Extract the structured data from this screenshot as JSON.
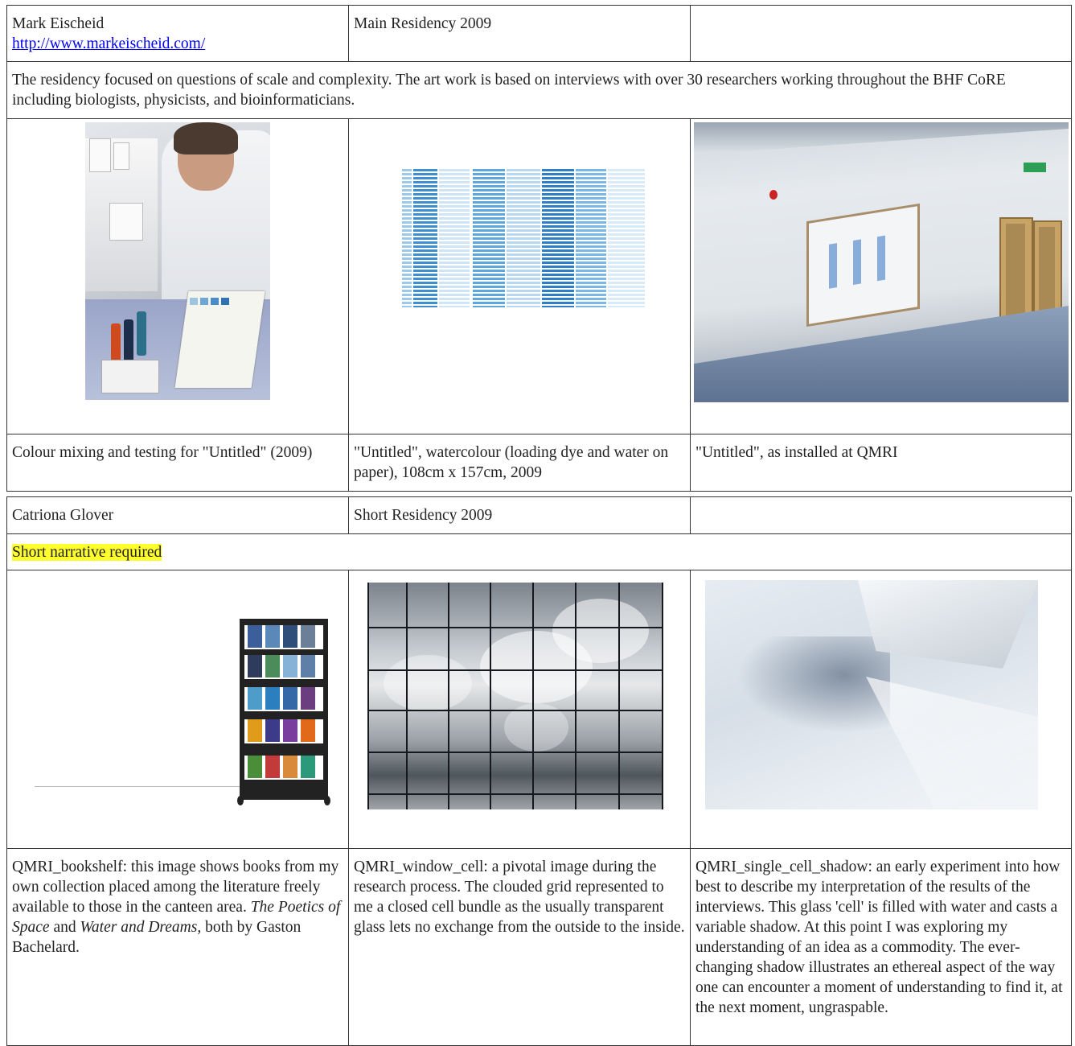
{
  "mark": {
    "artist_name": "Mark Eischeid",
    "url": "http://www.markeischeid.com/",
    "residency": "Main Residency 2009",
    "description": "The residency focused on questions of scale and complexity.  The art work is based on interviews with over 30 researchers working throughout the BHF CoRE including biologists, physicists, and bioinformaticians.",
    "captions": [
      "Colour mixing and testing for \"Untitled\" (2009)",
      "\"Untitled\", watercolour (loading dye and water on paper), 108cm x 157cm, 2009",
      "\"Untitled\", as installed at QMRI"
    ]
  },
  "catriona": {
    "artist_name": "Catriona Glover",
    "residency": "Short Residency 2009",
    "narrative_note": "Short narrative required",
    "caption1": {
      "text_a": "QMRI_bookshelf: this image shows books from my own collection placed among the literature freely available to those in the canteen area. ",
      "title_a": "The Poetics of Space",
      "text_b": " and ",
      "title_b": "Water and Dreams,",
      "text_c": " both by Gaston Bachelard."
    },
    "caption2": "QMRI_window_cell: a pivotal image during the research process.  The clouded grid represented to me a closed cell bundle as the usually transparent glass lets no exchange from the outside to the inside.",
    "caption3": "QMRI_single_cell_shadow: an early experiment into how best to describe my interpretation of the results of the interviews.  This glass 'cell' is filled with water and casts a variable shadow.  At this point I was exploring my understanding of an idea as a commodity.  The ever-changing shadow illustrates an ethereal aspect of the way one can encounter a moment of understanding to find it, at the next moment, ungraspable."
  },
  "colors": {
    "highlight": "#ffff2e",
    "link": "#0000ee",
    "border": "#333333"
  }
}
